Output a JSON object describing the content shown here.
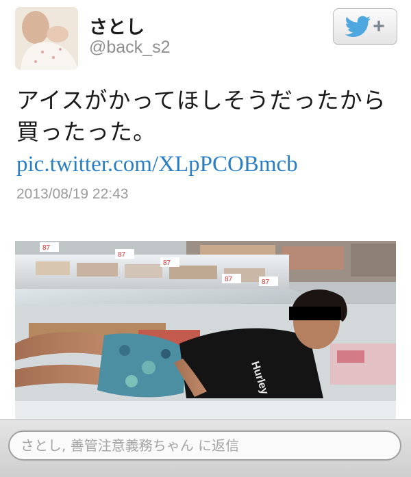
{
  "tweet": {
    "user_name": "さとし",
    "user_handle": "@back_s2",
    "text": "アイスがかってほしそうだったから買ったった。",
    "link": "pic.twitter.com/XLpPCOBmcb",
    "timestamp": "2013/08/19 22:43"
  },
  "follow_button": {
    "icon": "twitter-bird-icon",
    "symbol": "+"
  },
  "photo": {
    "price_tags": [
      "87",
      "87",
      "87",
      "87",
      "87"
    ],
    "shirt_text": "Hurley"
  },
  "reply": {
    "placeholder": "さとし, 善管注意義務ちゃん に返信"
  },
  "colors": {
    "link": "#2a7fc4",
    "handle": "#8e8e8e",
    "twitter_bird": "#4fa7e0"
  }
}
